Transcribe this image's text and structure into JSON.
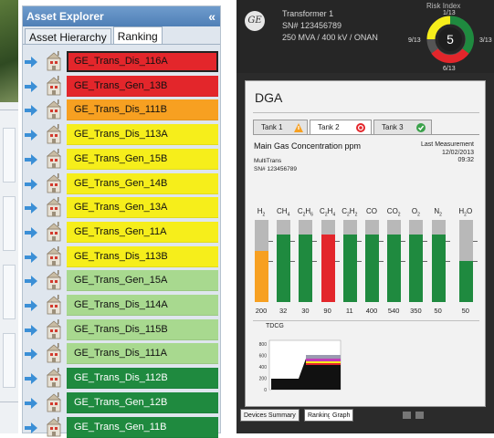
{
  "explorer": {
    "title": "Asset Explorer",
    "collapse_glyph": "«",
    "tabs": [
      {
        "label": "Asset Hierarchy",
        "active": false
      },
      {
        "label": "Ranking",
        "active": true
      }
    ],
    "rows": [
      {
        "name": "GE_Trans_Dis_116A",
        "color": "#e3262b",
        "selected": true
      },
      {
        "name": "GE_Trans_Gen_13B",
        "color": "#e3262b",
        "selected": false
      },
      {
        "name": "GE_Trans_Dis_111B",
        "color": "#f7a021",
        "selected": false
      },
      {
        "name": "GE_Trans_Dis_113A",
        "color": "#f6ee1b",
        "selected": false
      },
      {
        "name": "GE_Trans_Gen_15B",
        "color": "#f6ee1b",
        "selected": false
      },
      {
        "name": "GE_Trans_Gen_14B",
        "color": "#f6ee1b",
        "selected": false
      },
      {
        "name": "GE_Trans_Gen_13A",
        "color": "#f6ee1b",
        "selected": false
      },
      {
        "name": "GE_Trans_Gen_11A",
        "color": "#f6ee1b",
        "selected": false
      },
      {
        "name": "GE_Trans_Dis_113B",
        "color": "#f6ee1b",
        "selected": false
      },
      {
        "name": "GE_Trans_Gen_15A",
        "color": "#a8d98f",
        "selected": false
      },
      {
        "name": "GE_Trans_Dis_114A",
        "color": "#a8d98f",
        "selected": false
      },
      {
        "name": "GE_Trans_Dis_115B",
        "color": "#a8d98f",
        "selected": false
      },
      {
        "name": "GE_Trans_Dis_111A",
        "color": "#a8d98f",
        "selected": false
      },
      {
        "name": "GE_Trans_Dis_112B",
        "color": "#1f8a3f",
        "selected": false
      },
      {
        "name": "GE_Trans_Gen_12B",
        "color": "#1f8a3f",
        "selected": false
      },
      {
        "name": "GE_Trans_Gen_11B",
        "color": "#1f8a3f",
        "selected": false
      }
    ]
  },
  "device": {
    "logo": "GE",
    "transformer_lines": [
      "Transformer 1",
      "SN# 123456789",
      "250 MVA / 400 kV / ONAN"
    ],
    "risk": {
      "title": "Risk Index",
      "value": "5",
      "top": "1/13",
      "left": "9/13",
      "right": "3/13",
      "bottom": "6/13"
    },
    "dga": {
      "title": "DGA",
      "tabs": [
        {
          "label": "Tank 1",
          "status_icon": "warning-icon",
          "active": false
        },
        {
          "label": "Tank 2",
          "status_icon": "alarm-icon",
          "active": true
        },
        {
          "label": "Tank 3",
          "status_icon": "ok-icon",
          "active": false
        }
      ],
      "heading": "Main Gas Concentration ppm",
      "last_measurement_label": "Last Measurement",
      "last_measurement_date": "12/02/2013",
      "last_measurement_time": "09:32",
      "device_name": "MultiTrans",
      "device_sn": "SN# 123456789",
      "gases": [
        {
          "formula": "H",
          "sub": "2",
          "value": "200",
          "level": 0.62,
          "color": "#f7a021"
        },
        {
          "formula": "CH",
          "sub": "4",
          "value": "32",
          "level": 0.82,
          "color": "#1f8a3f"
        },
        {
          "formula": "C",
          "sub": "2",
          "formula2": "H",
          "sub2": "6",
          "value": "30",
          "level": 0.82,
          "color": "#1f8a3f"
        },
        {
          "formula": "C",
          "sub": "2",
          "formula2": "H",
          "sub2": "4",
          "value": "90",
          "level": 0.82,
          "color": "#e3262b"
        },
        {
          "formula": "C",
          "sub": "2",
          "formula2": "H",
          "sub2": "2",
          "value": "11",
          "level": 0.82,
          "color": "#1f8a3f"
        },
        {
          "formula": "CO",
          "sub": "",
          "value": "400",
          "level": 0.82,
          "color": "#1f8a3f"
        },
        {
          "formula": "CO",
          "sub": "2",
          "value": "540",
          "level": 0.82,
          "color": "#1f8a3f"
        },
        {
          "formula": "O",
          "sub": "2",
          "value": "350",
          "level": 0.82,
          "color": "#1f8a3f"
        },
        {
          "formula": "N",
          "sub": "2",
          "value": "50",
          "level": 0.82,
          "color": "#1f8a3f"
        },
        {
          "formula": "H",
          "sub": "2",
          "formula2": "O",
          "sub2": "",
          "value": "50",
          "level": 0.5,
          "color": "#1f8a3f"
        }
      ],
      "tdcg": {
        "title": "TDCG",
        "y_ticks": [
          "800",
          "600",
          "400",
          "200",
          "0"
        ]
      }
    },
    "bottom_tabs": [
      "Devices Summary",
      "Ranking",
      "Graph"
    ]
  }
}
